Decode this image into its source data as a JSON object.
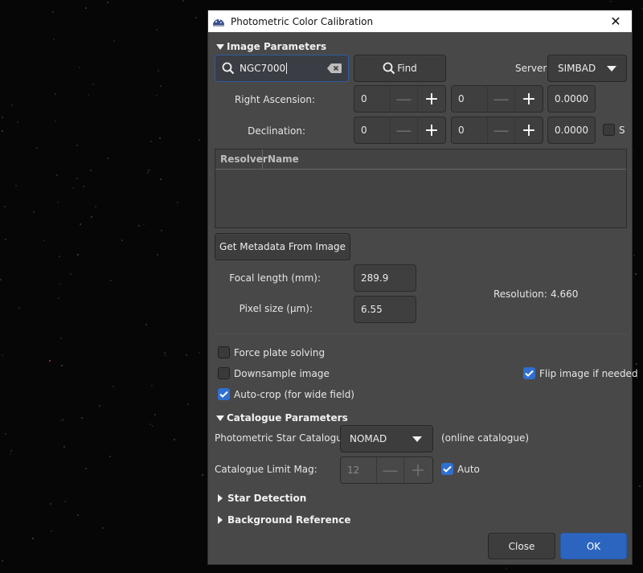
{
  "background": {
    "description": "astronomical star field image"
  },
  "window": {
    "title": "Photometric Color Calibration",
    "close_glyph": "✕",
    "app_icon": "siril-dome-icon"
  },
  "image_parameters": {
    "header": "Image Parameters",
    "expanded": true,
    "search": {
      "value": "NGC7000",
      "placeholder": "",
      "search_icon": "search-icon",
      "clear_icon": "clear-text-icon"
    },
    "find_button": {
      "label": "Find",
      "icon": "search-icon"
    },
    "server": {
      "label": "Server:",
      "selected": "SIMBAD"
    },
    "right_ascension": {
      "label": "Right Ascension:",
      "hours": "0",
      "minutes": "0",
      "seconds": "0.0000"
    },
    "declination": {
      "label": "Declination:",
      "degrees": "0",
      "minutes": "0",
      "seconds": "0.0000",
      "south_label": "S",
      "south_checked": false
    },
    "resolver_table": {
      "columns": [
        "Resolver",
        "Name"
      ],
      "rows": []
    },
    "get_metadata_button": "Get Metadata From Image",
    "focal_length": {
      "label": "Focal length (mm):",
      "value": "289.9"
    },
    "pixel_size": {
      "label": "Pixel size (µm):",
      "value": "6.55"
    },
    "resolution": {
      "label": "Resolution:",
      "value": "4.660"
    }
  },
  "options": {
    "force_plate_solving": {
      "label": "Force plate solving",
      "checked": false
    },
    "downsample_image": {
      "label": "Downsample image",
      "checked": false
    },
    "flip_image": {
      "label": "Flip image if needed",
      "checked": true
    },
    "auto_crop": {
      "label": "Auto-crop (for wide field)",
      "checked": true
    }
  },
  "catalogue_parameters": {
    "header": "Catalogue Parameters",
    "expanded": true,
    "star_catalogue": {
      "label": "Photometric Star Catalogue:",
      "selected": "NOMAD",
      "note": "(online catalogue)"
    },
    "limit_mag": {
      "label": "Catalogue Limit Mag:",
      "value": "12",
      "auto_label": "Auto",
      "auto_checked": true
    }
  },
  "star_detection": {
    "header": "Star Detection",
    "expanded": false
  },
  "background_reference": {
    "header": "Background Reference",
    "expanded": false
  },
  "footer": {
    "close_label": "Close",
    "ok_label": "OK"
  },
  "colors": {
    "accent": "#2c65c0",
    "checkbox_checked": "#2f6fd0",
    "panel": "#484848",
    "titlebar": "#ffffff"
  }
}
